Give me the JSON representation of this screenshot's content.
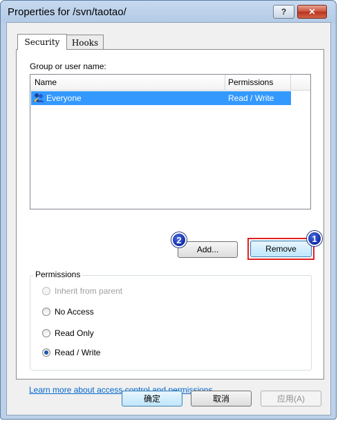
{
  "window": {
    "title": "Properties for /svn/taotao/",
    "help_label": "?",
    "close_label": "✕"
  },
  "tabs": [
    {
      "label": "Security"
    },
    {
      "label": "Hooks"
    }
  ],
  "security": {
    "group_label": "Group or user name:",
    "columns": {
      "name": "Name",
      "permissions": "Permissions"
    },
    "rows": [
      {
        "name": "Everyone",
        "permissions": "Read / Write"
      }
    ],
    "add_label": "Add...",
    "remove_label": "Remove",
    "markers": [
      "1",
      "2"
    ],
    "permissions_title": "Permissions",
    "radios": [
      {
        "label": "Inherit from parent"
      },
      {
        "label": "No Access"
      },
      {
        "label": "Read Only"
      },
      {
        "label": "Read / Write"
      }
    ],
    "help_link": "Learn more about access control and permissions"
  },
  "footer": {
    "ok_label": "确定",
    "cancel_label": "取消",
    "apply_label": "应用(A)"
  },
  "colors": {
    "selection": "#3399ff",
    "highlight": "#e02020",
    "link": "#0066cc"
  }
}
